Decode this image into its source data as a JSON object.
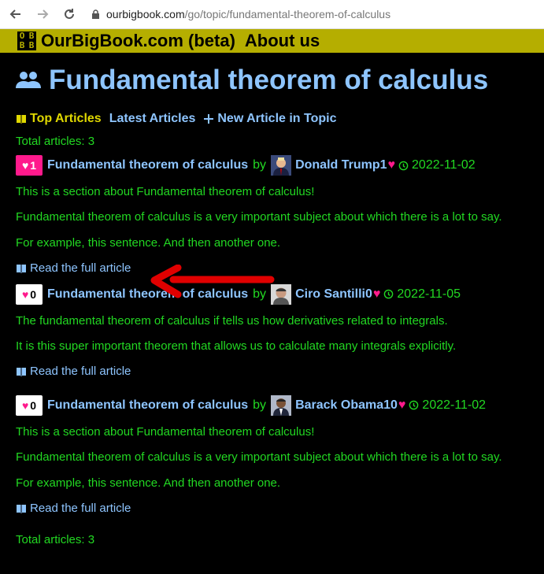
{
  "browser": {
    "url_host": "ourbigbook.com",
    "url_path": "/go/topic/fundamental-theorem-of-calculus"
  },
  "site": {
    "logo_letters": [
      "O",
      "B",
      "B",
      "B"
    ],
    "brand": "OurBigBook.com (beta)",
    "about": "About us"
  },
  "page_title": "Fundamental theorem of calculus",
  "tabs": {
    "top": "Top Articles",
    "latest": "Latest Articles",
    "new": "New Article in Topic"
  },
  "total_top": "Total articles: 3",
  "total_bottom": "Total articles: 3",
  "articles": [
    {
      "likes": "1",
      "title": "Fundamental theorem of calculus",
      "by": "by",
      "author": "Donald Trump",
      "score": "1",
      "date": "2022-11-02",
      "paragraphs": [
        "This is a section about Fundamental theorem of calculus!",
        "Fundamental theorem of calculus is a very important subject about which there is a lot to say.",
        "For example, this sentence. And then another one."
      ],
      "read": "Read the full article"
    },
    {
      "likes": "0",
      "title": "Fundamental theorem of calculus",
      "by": "by",
      "author": "Ciro Santilli",
      "score": "0",
      "date": "2022-11-05",
      "paragraphs": [
        "The fundamental theorem of calculus if tells us how derivatives related to integrals.",
        "It is this super important theorem that allows us to calculate many integrals explicitly."
      ],
      "read": "Read the full article"
    },
    {
      "likes": "0",
      "title": "Fundamental theorem of calculus",
      "by": "by",
      "author": "Barack Obama",
      "score": "10",
      "date": "2022-11-02",
      "paragraphs": [
        "This is a section about Fundamental theorem of calculus!",
        "Fundamental theorem of calculus is a very important subject about which there is a lot to say.",
        "For example, this sentence. And then another one."
      ],
      "read": "Read the full article"
    }
  ],
  "colors": {
    "accent": "#8ec5ff",
    "text_green": "#22d822",
    "heart": "#ff1a8c",
    "topbar": "#b5ae00",
    "annotation_arrow": "#e00000"
  }
}
